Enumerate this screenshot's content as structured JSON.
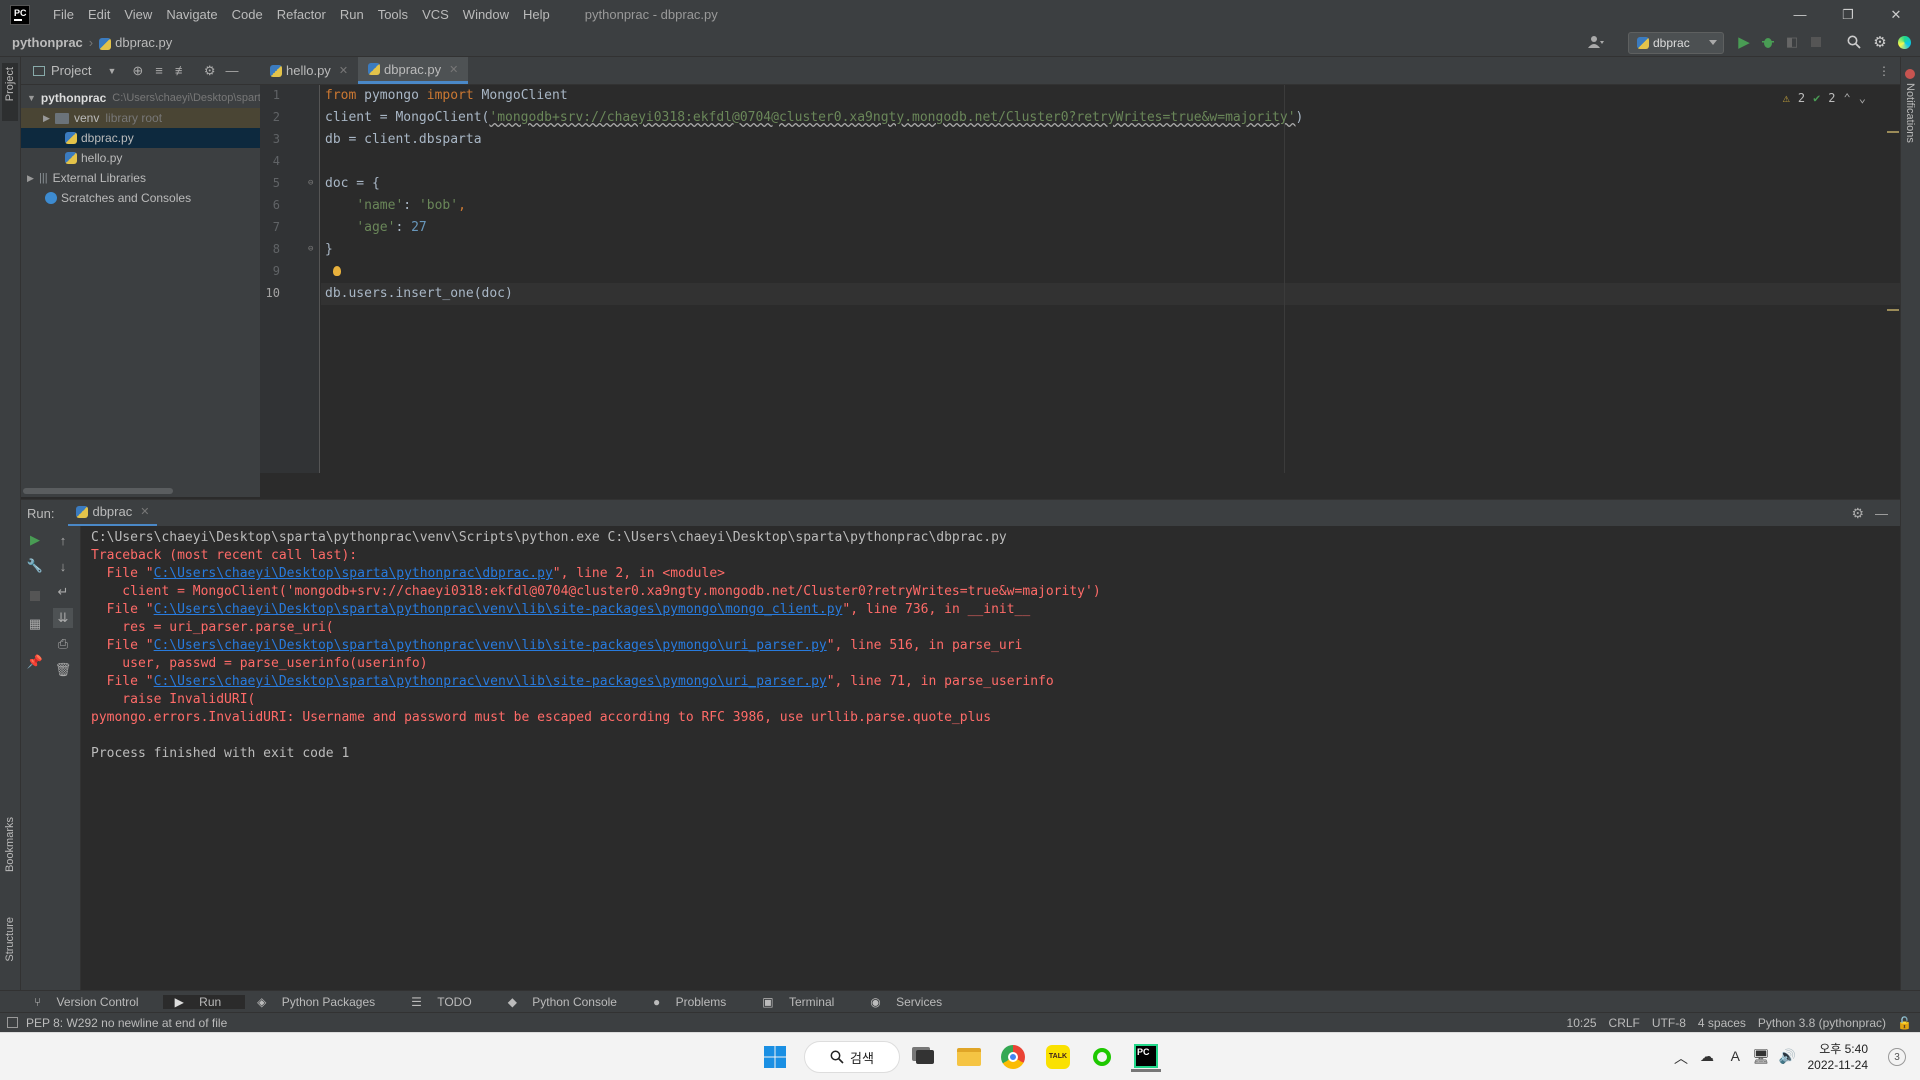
{
  "window": {
    "title": "pythonprac - dbprac.py",
    "minimize": "—",
    "maximize": "❐",
    "close": "✕"
  },
  "menu": [
    "File",
    "Edit",
    "View",
    "Navigate",
    "Code",
    "Refactor",
    "Run",
    "Tools",
    "VCS",
    "Window",
    "Help"
  ],
  "navbar": {
    "project": "pythonprac",
    "file": "dbprac.py",
    "run_config": "dbprac"
  },
  "project_panel": {
    "title": "Project",
    "tree": [
      {
        "label": "pythonprac",
        "hint": "C:\\Users\\chaeyi\\Desktop\\sparta\\pythonprac",
        "kind": "folder",
        "level": 0,
        "expanded": true
      },
      {
        "label": "venv",
        "hint": "library root",
        "kind": "folder-dark",
        "level": 1,
        "expanded": false
      },
      {
        "label": "dbprac.py",
        "hint": "",
        "kind": "py",
        "level": 2,
        "selected": true
      },
      {
        "label": "hello.py",
        "hint": "",
        "kind": "py",
        "level": 2
      },
      {
        "label": "External Libraries",
        "hint": "",
        "kind": "lib",
        "level": 0,
        "expanded": false
      },
      {
        "label": "Scratches and Consoles",
        "hint": "",
        "kind": "scratch",
        "level": 1
      }
    ]
  },
  "editor": {
    "tabs": [
      {
        "label": "hello.py",
        "active": false
      },
      {
        "label": "dbprac.py",
        "active": true
      }
    ],
    "inspections": {
      "warnings": "2",
      "weak": "2"
    },
    "line_numbers": [
      "1",
      "2",
      "3",
      "4",
      "5",
      "6",
      "7",
      "8",
      "9",
      "10"
    ],
    "code": {
      "l1_kw1": "from",
      "l1_mod": " pymongo ",
      "l1_kw2": "import",
      "l1_name": " MongoClient",
      "l2_a": "client = MongoClient(",
      "l2_str": "'mongodb+srv://chaeyi0318:ekfdl@0704@cluster0.xa9ngty.mongodb.net/Cluster0?retryWrites=true&w=majority'",
      "l2_b": ")",
      "l3": "db = client.dbsparta",
      "l5": "doc = {",
      "l6_key": "'name'",
      "l6_mid": ": ",
      "l6_val": "'bob'",
      "l6_end": ",",
      "l7_key": "'age'",
      "l7_mid": ": ",
      "l7_val": "27",
      "l8": "}",
      "l10": "db.users.insert_one(doc)"
    }
  },
  "run_panel": {
    "label": "Run:",
    "tab": "dbprac",
    "output": {
      "cmd": "C:\\Users\\chaeyi\\Desktop\\sparta\\pythonprac\\venv\\Scripts\\python.exe C:\\Users\\chaeyi\\Desktop\\sparta\\pythonprac\\dbprac.py",
      "tb_head": "Traceback (most recent call last):",
      "f1_pre": "  File \"",
      "f1_link": "C:\\Users\\chaeyi\\Desktop\\sparta\\pythonprac\\dbprac.py",
      "f1_post": "\", line 2, in <module>",
      "f1_code": "    client = MongoClient('mongodb+srv://chaeyi0318:ekfdl@0704@cluster0.xa9ngty.mongodb.net/Cluster0?retryWrites=true&w=majority')",
      "f2_pre": "  File \"",
      "f2_link": "C:\\Users\\chaeyi\\Desktop\\sparta\\pythonprac\\venv\\lib\\site-packages\\pymongo\\mongo_client.py",
      "f2_post": "\", line 736, in __init__",
      "f2_code": "    res = uri_parser.parse_uri(",
      "f3_pre": "  File \"",
      "f3_link": "C:\\Users\\chaeyi\\Desktop\\sparta\\pythonprac\\venv\\lib\\site-packages\\pymongo\\uri_parser.py",
      "f3_post": "\", line 516, in parse_uri",
      "f3_code": "    user, passwd = parse_userinfo(userinfo)",
      "f4_pre": "  File \"",
      "f4_link": "C:\\Users\\chaeyi\\Desktop\\sparta\\pythonprac\\venv\\lib\\site-packages\\pymongo\\uri_parser.py",
      "f4_post": "\", line 71, in parse_userinfo",
      "f4_code": "    raise InvalidURI(",
      "error": "pymongo.errors.InvalidURI: Username and password must be escaped according to RFC 3986, use urllib.parse.quote_plus",
      "exit": "Process finished with exit code 1"
    }
  },
  "tool_windows": [
    "Version Control",
    "Run",
    "Python Packages",
    "TODO",
    "Python Console",
    "Problems",
    "Terminal",
    "Services"
  ],
  "side_labels": {
    "project": "Project",
    "bookmarks": "Bookmarks",
    "structure": "Structure",
    "notifications": "Notifications"
  },
  "statusbar": {
    "message": "PEP 8: W292 no newline at end of file",
    "position": "10:25",
    "line_sep": "CRLF",
    "encoding": "UTF-8",
    "indent": "4 spaces",
    "interpreter": "Python 3.8 (pythonprac)"
  },
  "taskbar": {
    "search": "검색",
    "time": "오후 5:40",
    "date": "2022-11-24",
    "notifications": "3"
  },
  "colors": {
    "accent": "#4a88c7",
    "error_text": "#ff6b68",
    "link": "#287bde",
    "run_green": "#499c54",
    "keyword": "#cc7832",
    "string": "#6a8759",
    "number": "#6897bb"
  }
}
